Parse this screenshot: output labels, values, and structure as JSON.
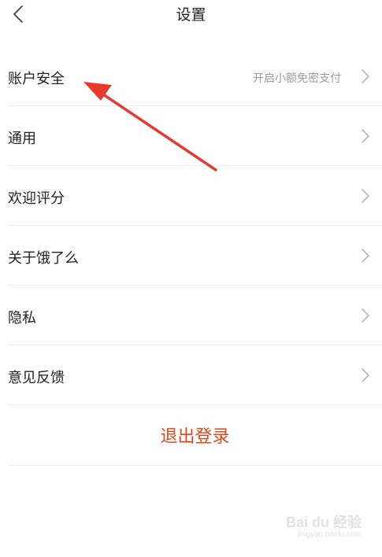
{
  "header": {
    "title": "设置",
    "back_icon": "chevron-left-icon"
  },
  "settings": {
    "items": [
      {
        "label": "账户安全",
        "hint": "开启小额免密支付"
      },
      {
        "label": "通用",
        "hint": ""
      },
      {
        "label": "欢迎评分",
        "hint": ""
      },
      {
        "label": "关于饿了么",
        "hint": ""
      },
      {
        "label": "隐私",
        "hint": ""
      },
      {
        "label": "意见反馈",
        "hint": ""
      }
    ],
    "logout_label": "退出登录"
  },
  "colors": {
    "accent": "#d9491f",
    "annotation_arrow": "#e8392f",
    "divider": "#ececec",
    "hint_text": "#9a9a9a"
  },
  "watermark": {
    "brand": "Bai du 经验",
    "url": "jingyan.baidu.com"
  }
}
